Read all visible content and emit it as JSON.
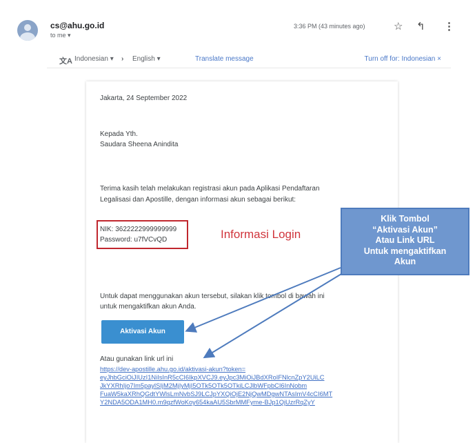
{
  "header": {
    "sender": "cs@ahu.go.id",
    "to": "to me ▾",
    "time": "3:36 PM (43 minutes ago)",
    "icons": [
      "star-icon",
      "reply-icon",
      "more-vert-icon"
    ]
  },
  "translate_bar": {
    "source_lang": "Indonesian ▾",
    "target_lang": "English ▾",
    "translate_link": "Translate message",
    "turn_off": "Turn off for: Indonesian ×"
  },
  "email": {
    "date_line": "Jakarta, 24 September 2022",
    "greeting_1": "Kepada Yth.",
    "greeting_2": "Saudara Sheena Anindita",
    "intro_1": "Terima kasih telah melakukan registrasi akun pada Aplikasi Pendaftaran",
    "intro_2": "Legalisasi dan Apostille, dengan informasi akun sebagai berikut:",
    "nik": "NIK: 3622222999999999",
    "password": "Password: u7fVCvQD",
    "instr_1": "Untuk dapat menggunakan akun tersebut, silakan klik tombol di bawah ini",
    "instr_2": "untuk mengaktifkan akun Anda.",
    "button_label": "Aktivasi Akun",
    "alt_link_label": "Atau gunakan link url ini",
    "link_lines": [
      "https://dev-apostille.ahu.go.id/aktivasi-akun?token=",
      "eyJhbGciOiJIUzI1NiIsInR5cCI6IkpXVCJ9.eyJpc3MiOiJBdXRoIFNlcnZpY2UiLC",
      "JkYXRhIjo7Im5paylSIjM2MjIyMjI5OTk5OTk5OTkiLCJlbWFpbCI6InNobm",
      "FuaW5kaXRhQGdtYWlsLmNvbSJ9LCJpYXQiOjE2NjQwMDgwNTAsImV4cCI6MT",
      "Y2NDA5ODA1MH0.m9qzfWoKoy654kaAU5SbrMMFyme-BJp1QjUzrRqZyY"
    ]
  },
  "annotation": {
    "login_label": "Informasi Login",
    "callout_lines": [
      "Klik Tombol",
      "“Aktivasi Akun”",
      "Atau Link URL",
      "Untuk mengaktifkan",
      "Akun"
    ],
    "colors": {
      "login_box": "#c0262d",
      "callout_bg": "#6f97cf",
      "arrow": "#4e7bbd",
      "button": "#3a8fd0"
    }
  }
}
